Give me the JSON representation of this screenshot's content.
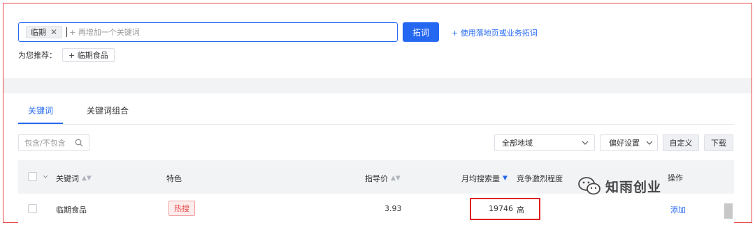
{
  "search": {
    "tag": "临期",
    "tag_close": "✕",
    "placeholder": "+ 再增加一个关键词",
    "submit_label": "拓词",
    "expand_link": "+ 使用落地页或业务拓词"
  },
  "recommend": {
    "label": "为您推荐：",
    "chips": [
      {
        "label": "+ 临期食品"
      }
    ]
  },
  "tabs": [
    {
      "label": "关键词",
      "active": true
    },
    {
      "label": "关键词组合",
      "active": false
    }
  ],
  "filter": {
    "placeholder": "包含/不包含",
    "region": "全部地域",
    "preference": "偏好设置",
    "custom_label": "自定义",
    "download_label": "下载"
  },
  "table": {
    "headers": {
      "keyword": "关键词",
      "feature": "特色",
      "price": "指导价",
      "monthly_search": "月均搜索量",
      "competition": "竞争激烈程度",
      "operation": "操作"
    },
    "rows": [
      {
        "keyword": "临期食品",
        "feature": "热搜",
        "price": "3.93",
        "monthly_search": "19746",
        "competition": "高",
        "action": "添加"
      }
    ]
  },
  "watermark": {
    "text": "知雨创业"
  },
  "colors": {
    "accent": "#2468f2",
    "highlight": "#e02020",
    "hot": "#e84b4b"
  }
}
